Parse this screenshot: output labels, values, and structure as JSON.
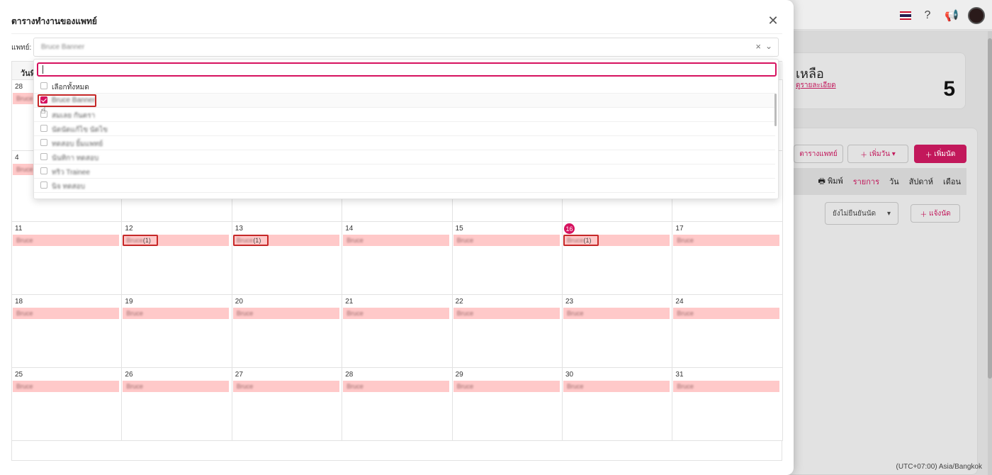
{
  "background": {
    "card": {
      "title": "เหลือ",
      "link": "ดูรายละเอียด",
      "count": "5"
    },
    "buttons": {
      "doctor_schedule": "ตารางแพทย์",
      "add_day": "เพิ่มวัน",
      "add_appt": "เพิ่มนัด",
      "notify": "แจ้งนัด"
    },
    "view_tabs": {
      "print": "พิมพ์",
      "list": "รายการ",
      "day": "วัน",
      "week": "สัปดาห์",
      "month": "เดือน"
    },
    "status_select": "ยังไม่ยืนยันนัด",
    "timezone": "(UTC+07:00) Asia/Bangkok"
  },
  "modal": {
    "title": "ตารางทำงานของแพทย์",
    "doctor_label": "แพทย์:",
    "doctor_value": "Bruce Banner",
    "calendar_header": "วันที่",
    "dropdown": {
      "select_all": "เลือกทั้งหมด",
      "options": [
        {
          "label": "Bruce Banner",
          "checked": true
        },
        {
          "label": "สมเลย กันตรา",
          "checked": false
        },
        {
          "label": "นัดนัดแก้ไข นัดไข",
          "checked": false
        },
        {
          "label": "ทดสอบ ยิ้มแพทย์",
          "checked": false
        },
        {
          "label": "นันทิกา ทดสอบ",
          "checked": false
        },
        {
          "label": "ทริว Trainee",
          "checked": false
        },
        {
          "label": "นิจ ทดสอบ",
          "checked": false
        }
      ]
    },
    "weeks": [
      {
        "days": [
          {
            "n": "28",
            "ev": "Bruce"
          },
          {
            "n": "",
            "ev": ""
          },
          {
            "n": "",
            "ev": ""
          },
          {
            "n": "",
            "ev": ""
          },
          {
            "n": "",
            "ev": ""
          },
          {
            "n": "",
            "ev": ""
          },
          {
            "n": "",
            "ev": ""
          }
        ]
      },
      {
        "days": [
          {
            "n": "4",
            "ev": "Bruce"
          },
          {
            "n": "",
            "ev": ""
          },
          {
            "n": "",
            "ev": ""
          },
          {
            "n": "",
            "ev": ""
          },
          {
            "n": "",
            "ev": ""
          },
          {
            "n": "",
            "ev": ""
          },
          {
            "n": "",
            "ev": ""
          }
        ]
      },
      {
        "days": [
          {
            "n": "11",
            "ev": "Bruce"
          },
          {
            "n": "12",
            "ev": "Bruce",
            "count": "(1)"
          },
          {
            "n": "13",
            "ev": "Bruce",
            "count": "(1)"
          },
          {
            "n": "14",
            "ev": "Bruce"
          },
          {
            "n": "15",
            "ev": "Bruce"
          },
          {
            "n": "16",
            "ev": "Bruce",
            "count": "(1)",
            "today": true
          },
          {
            "n": "17",
            "ev": "Bruce"
          }
        ]
      },
      {
        "days": [
          {
            "n": "18",
            "ev": "Bruce"
          },
          {
            "n": "19",
            "ev": "Bruce"
          },
          {
            "n": "20",
            "ev": "Bruce"
          },
          {
            "n": "21",
            "ev": "Bruce"
          },
          {
            "n": "22",
            "ev": "Bruce"
          },
          {
            "n": "23",
            "ev": "Bruce"
          },
          {
            "n": "24",
            "ev": "Bruce"
          }
        ]
      },
      {
        "days": [
          {
            "n": "25",
            "ev": "Bruce"
          },
          {
            "n": "26",
            "ev": "Bruce"
          },
          {
            "n": "27",
            "ev": "Bruce"
          },
          {
            "n": "28",
            "ev": "Bruce"
          },
          {
            "n": "29",
            "ev": "Bruce"
          },
          {
            "n": "30",
            "ev": "Bruce"
          },
          {
            "n": "31",
            "ev": "Bruce"
          }
        ]
      }
    ]
  }
}
